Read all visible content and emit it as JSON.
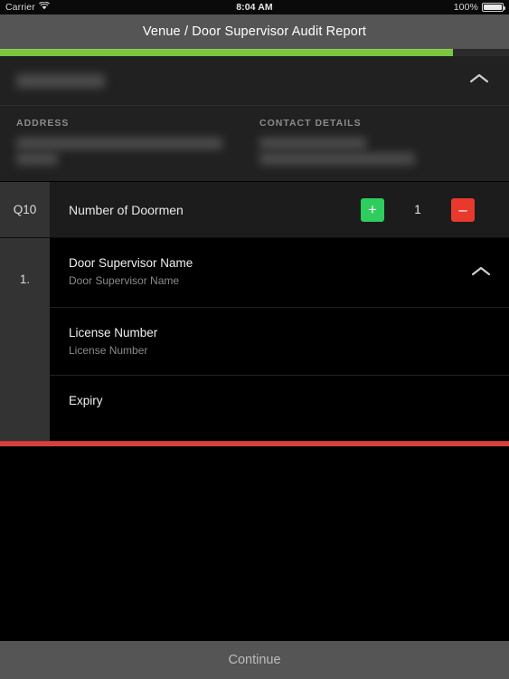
{
  "status_bar": {
    "carrier": "Carrier",
    "wifi_icon": "wifi-icon",
    "time": "8:04 AM",
    "battery_percent": "100%",
    "battery_icon": "battery-full-icon"
  },
  "nav": {
    "title": "Venue / Door Supervisor Audit Report"
  },
  "progress": {
    "percent": 89,
    "fill_color": "#79c63f",
    "track_color": "#2b2b2b"
  },
  "venue_header": {
    "venue_name_redacted": "",
    "collapse_icon": "chevron-up-icon"
  },
  "details": {
    "address": {
      "label": "ADDRESS",
      "value_redacted": ""
    },
    "contact": {
      "label": "CONTACT DETAILS",
      "value_redacted": ""
    }
  },
  "question": {
    "number": "Q10",
    "title": "Number of Doormen",
    "stepper": {
      "increment_label": "+",
      "decrement_label": "–",
      "value": "1",
      "increment_color": "#2fcc5e",
      "decrement_color": "#e8392c"
    }
  },
  "subitem": {
    "index": "1.",
    "collapse_icon": "chevron-up-icon",
    "fields": [
      {
        "label": "Door Supervisor Name",
        "placeholder": "Door Supervisor Name",
        "has_chevron": true
      },
      {
        "label": "License Number",
        "placeholder": "License Number",
        "has_chevron": false
      },
      {
        "label": "Expiry",
        "placeholder": "",
        "has_chevron": false
      }
    ]
  },
  "separator": {
    "color": "#d6403f"
  },
  "bottom": {
    "continue_label": "Continue"
  }
}
